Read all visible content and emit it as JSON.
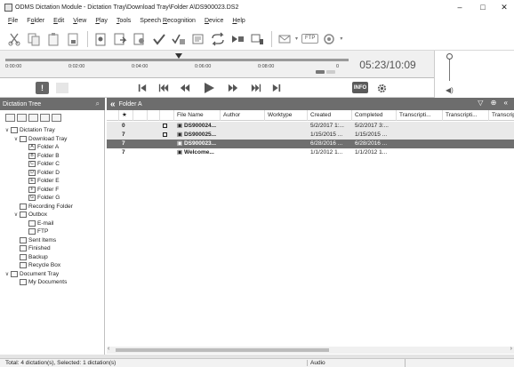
{
  "window": {
    "title": "ODMS Dictation Module - Dictation Tray\\Download Tray\\Folder A\\DS900023.DS2",
    "minimize": "–",
    "maximize": "□",
    "close": "✕"
  },
  "menu": [
    {
      "label": "File",
      "accel": "F"
    },
    {
      "label": "Folder",
      "accel": "o"
    },
    {
      "label": "Edit",
      "accel": "E"
    },
    {
      "label": "View",
      "accel": "V"
    },
    {
      "label": "Play",
      "accel": "P"
    },
    {
      "label": "Tools",
      "accel": "T"
    },
    {
      "label": "Speech Recognition",
      "accel": "R"
    },
    {
      "label": "Device",
      "accel": "D"
    },
    {
      "label": "Help",
      "accel": "H"
    }
  ],
  "toolbar": {
    "ftp_label": "FTP"
  },
  "player": {
    "ticks": [
      "0:00:00",
      "0:02:00",
      "0:04:00",
      "0:06:00",
      "0:08:00",
      "0"
    ],
    "position_fraction": 0.504,
    "time_display": "05:23/10:09"
  },
  "transport": {
    "info_label": "INFO"
  },
  "tree": {
    "header": "Dictation Tree",
    "items": [
      {
        "label": "Dictation Tray",
        "level": 0,
        "expander": "∨",
        "icon": "tray-icon"
      },
      {
        "label": "Download Tray",
        "level": 1,
        "expander": "∨",
        "icon": "download-tray-icon"
      },
      {
        "label": "Folder A",
        "level": 2,
        "expander": "",
        "icon": "folder-icon",
        "letter": "A"
      },
      {
        "label": "Folder B",
        "level": 2,
        "expander": "",
        "icon": "folder-icon",
        "letter": "B"
      },
      {
        "label": "Folder C",
        "level": 2,
        "expander": "",
        "icon": "folder-icon",
        "letter": "C"
      },
      {
        "label": "Folder D",
        "level": 2,
        "expander": "",
        "icon": "folder-icon",
        "letter": "D"
      },
      {
        "label": "Folder E",
        "level": 2,
        "expander": "",
        "icon": "folder-icon",
        "letter": "E"
      },
      {
        "label": "Folder F",
        "level": 2,
        "expander": "",
        "icon": "folder-icon",
        "letter": "F"
      },
      {
        "label": "Folder G",
        "level": 2,
        "expander": "",
        "icon": "folder-icon",
        "letter": "G"
      },
      {
        "label": "Recording Folder",
        "level": 1,
        "expander": "",
        "icon": "recording-folder-icon"
      },
      {
        "label": "Outbox",
        "level": 1,
        "expander": "∨",
        "icon": "outbox-icon"
      },
      {
        "label": "E-mail",
        "level": 2,
        "expander": "",
        "icon": "email-icon"
      },
      {
        "label": "FTP",
        "level": 2,
        "expander": "",
        "icon": "ftp-icon"
      },
      {
        "label": "Sent Items",
        "level": 1,
        "expander": "",
        "icon": "sent-items-icon"
      },
      {
        "label": "Finished",
        "level": 1,
        "expander": "",
        "icon": "finished-icon"
      },
      {
        "label": "Backup",
        "level": 1,
        "expander": "",
        "icon": "backup-icon"
      },
      {
        "label": "Recycle Box",
        "level": 1,
        "expander": "",
        "icon": "recycle-box-icon"
      },
      {
        "label": "Document Tray",
        "level": 0,
        "expander": "∨",
        "icon": "document-tray-icon"
      },
      {
        "label": "My Documents",
        "level": 1,
        "expander": "",
        "icon": "my-documents-icon"
      }
    ]
  },
  "list": {
    "header": "Folder A",
    "columns": [
      "",
      "★",
      "",
      "",
      "",
      "File Name",
      "Author",
      "Worktype",
      "Created",
      "Completed",
      "Transcripti...",
      "Transcripti...",
      "Transcript"
    ],
    "rows": [
      {
        "priority": "0",
        "locked": true,
        "file": "DS900024...",
        "author": "",
        "worktype": "",
        "created": "5/2/2017 1:...",
        "completed": "5/2/2017 3:...",
        "style": "alt"
      },
      {
        "priority": "7",
        "locked": true,
        "file": "DS900025...",
        "author": "",
        "worktype": "",
        "created": "1/15/2015 ...",
        "completed": "1/15/2015 ...",
        "style": "alt"
      },
      {
        "priority": "7",
        "locked": false,
        "file": "DS900023...",
        "author": "",
        "worktype": "",
        "created": "6/28/2016 ...",
        "completed": "6/28/2016 ...",
        "style": "sel"
      },
      {
        "priority": "7",
        "locked": false,
        "file": "Welcome...",
        "author": "",
        "worktype": "",
        "created": "1/1/2012 1...",
        "completed": "1/1/2012 1...",
        "style": "normal"
      }
    ]
  },
  "status": {
    "left": "Total: 4 dictation(s), Selected: 1 dictation(s)",
    "middle": "Audio"
  }
}
